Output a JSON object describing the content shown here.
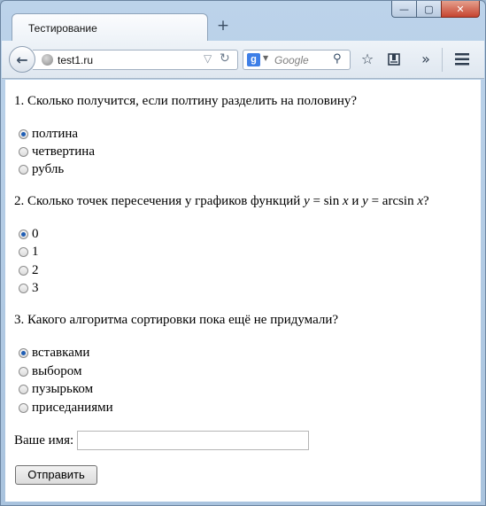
{
  "window": {
    "controls": {
      "minimize": "—",
      "maximize": "▢",
      "close": "✕"
    }
  },
  "tab": {
    "title": "Тестирование",
    "new_tab_symbol": "+"
  },
  "navbar": {
    "back_symbol": "←",
    "url": "test1.ru",
    "search_placeholder": "Google",
    "search_engine_letter": "g"
  },
  "form": {
    "questions": [
      {
        "text": "1. Сколько получится, если полтину разделить на половину?",
        "options": [
          {
            "label": "полтина",
            "checked": true
          },
          {
            "label": "четвертина",
            "checked": false
          },
          {
            "label": "рубль",
            "checked": false
          }
        ]
      },
      {
        "text_parts": {
          "a": "2. Сколько точек пересечения у графиков функций ",
          "y1": "y",
          "b": " = sin ",
          "x1": "x",
          "c": " и ",
          "y2": "y",
          "d": " = arcsin ",
          "x2": "x",
          "e": "?"
        },
        "options": [
          {
            "label": "0",
            "checked": true
          },
          {
            "label": "1",
            "checked": false
          },
          {
            "label": "2",
            "checked": false
          },
          {
            "label": "3",
            "checked": false
          }
        ]
      },
      {
        "text": "3. Какого алгоритма сортировки пока ещё не придумали?",
        "options": [
          {
            "label": "вставками",
            "checked": true
          },
          {
            "label": "выбором",
            "checked": false
          },
          {
            "label": "пузырьком",
            "checked": false
          },
          {
            "label": "приседаниями",
            "checked": false
          }
        ]
      }
    ],
    "name_label": "Ваше имя:",
    "name_value": "",
    "submit_label": "Отправить"
  }
}
